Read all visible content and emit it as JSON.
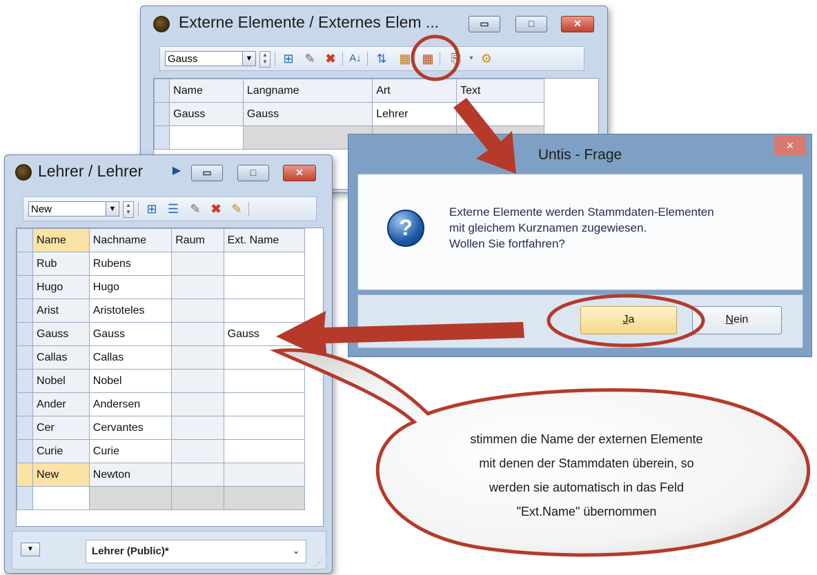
{
  "ext_window": {
    "title": "Externe Elemente / Externes Elem ...",
    "toolbar_combo": "Gauss",
    "columns": [
      "Name",
      "Langname",
      "Art",
      "Text"
    ],
    "rows": [
      {
        "name": "Gauss",
        "langname": "Gauss",
        "art": "Lehrer",
        "text": ""
      }
    ]
  },
  "lehrer_window": {
    "title": "Lehrer / Lehrer",
    "toolbar_combo": "New",
    "columns": [
      "Name",
      "Nachname",
      "Raum",
      "Ext. Name"
    ],
    "rows": [
      {
        "name": "Rub",
        "nachname": "Rubens",
        "raum": "",
        "ext": ""
      },
      {
        "name": "Hugo",
        "nachname": "Hugo",
        "raum": "",
        "ext": ""
      },
      {
        "name": "Arist",
        "nachname": "Aristoteles",
        "raum": "",
        "ext": ""
      },
      {
        "name": "Gauss",
        "nachname": "Gauss",
        "raum": "",
        "ext": "Gauss"
      },
      {
        "name": "Callas",
        "nachname": "Callas",
        "raum": "",
        "ext": ""
      },
      {
        "name": "Nobel",
        "nachname": "Nobel",
        "raum": "",
        "ext": ""
      },
      {
        "name": "Ander",
        "nachname": "Andersen",
        "raum": "",
        "ext": ""
      },
      {
        "name": "Cer",
        "nachname": "Cervantes",
        "raum": "",
        "ext": ""
      },
      {
        "name": "Curie",
        "nachname": "Curie",
        "raum": "",
        "ext": ""
      },
      {
        "name": "New",
        "nachname": "Newton",
        "raum": "",
        "ext": ""
      }
    ],
    "status_select": "Lehrer (Public)*"
  },
  "dialog": {
    "title": "Untis - Frage",
    "close": "×",
    "message_lines": [
      "Externe Elemente werden Stammdaten-Elementen",
      "mit gleichem Kurznamen zugewiesen.",
      "Wollen Sie fortfahren?"
    ],
    "yes_underlined": "J",
    "yes_rest": "a",
    "no_underlined": "N",
    "no_rest": "ein"
  },
  "callout_lines": [
    "stimmen die Name der externen Elemente",
    "mit denen der Stammdaten überein, so",
    "werden sie automatisch in das Feld",
    "\"Ext.Name\" übernommen"
  ],
  "colors": {
    "annotation": "#b53a2a",
    "selected_cell": "#fbe3a6",
    "button_yes": "#fce8a8"
  }
}
